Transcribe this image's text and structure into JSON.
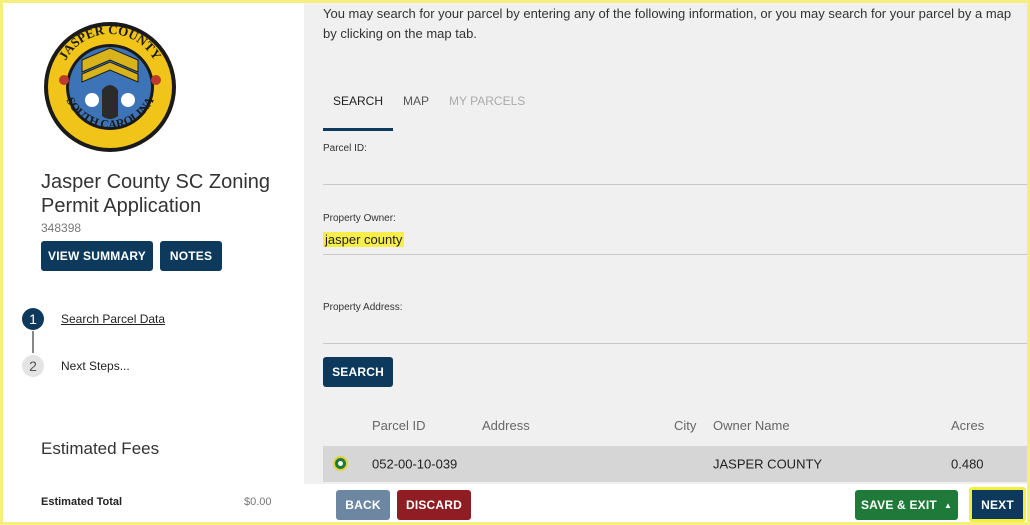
{
  "sidebar": {
    "seal": {
      "top_text": "JASPER COUNTY",
      "bottom_text": "SOUTH CAROLINA",
      "colors": {
        "ring": "#f0c419",
        "center": "#3d74b8",
        "edge": "#1a1a1a"
      }
    },
    "title": "Jasper County SC Zoning Permit Application",
    "record_id": "348398",
    "buttons": {
      "view_summary": "VIEW SUMMARY",
      "notes": "NOTES"
    },
    "steps": [
      {
        "number": "1",
        "label": "Search Parcel Data",
        "active": true
      },
      {
        "number": "2",
        "label": "Next Steps...",
        "active": false
      }
    ],
    "fees": {
      "title": "Estimated Fees",
      "total_label": "Estimated Total",
      "total_value": "$0.00"
    }
  },
  "main": {
    "intro": "You may search for your parcel by entering any of the following information, or you may search for your parcel by a map by clicking on the map tab.",
    "tabs": [
      {
        "label": "SEARCH",
        "selected": true
      },
      {
        "label": "MAP",
        "selected": false
      },
      {
        "label": "MY PARCELS",
        "selected": false
      }
    ],
    "fields": {
      "parcel_id": {
        "label": "Parcel ID:",
        "value": ""
      },
      "property_owner": {
        "label": "Property Owner:",
        "value": "jasper county"
      },
      "property_address": {
        "label": "Property Address:",
        "value": ""
      }
    },
    "search_button": "SEARCH",
    "table": {
      "columns": [
        "Parcel ID",
        "Address",
        "City",
        "Owner Name",
        "Acres"
      ],
      "rows": [
        {
          "parcel_id": "052-00-10-039",
          "address": "",
          "city": "",
          "owner": "JASPER COUNTY",
          "acres": "0.480",
          "selected": true
        }
      ]
    }
  },
  "footer": {
    "back": "BACK",
    "discard": "DISCARD",
    "save_exit": "SAVE & EXIT",
    "save_exit_icon": "caret-up-icon",
    "next": "NEXT"
  },
  "colors": {
    "navy": "#0d3a5c",
    "green": "#1f7a39",
    "maroon": "#8f1d23",
    "highlight": "#f7ee4a"
  }
}
